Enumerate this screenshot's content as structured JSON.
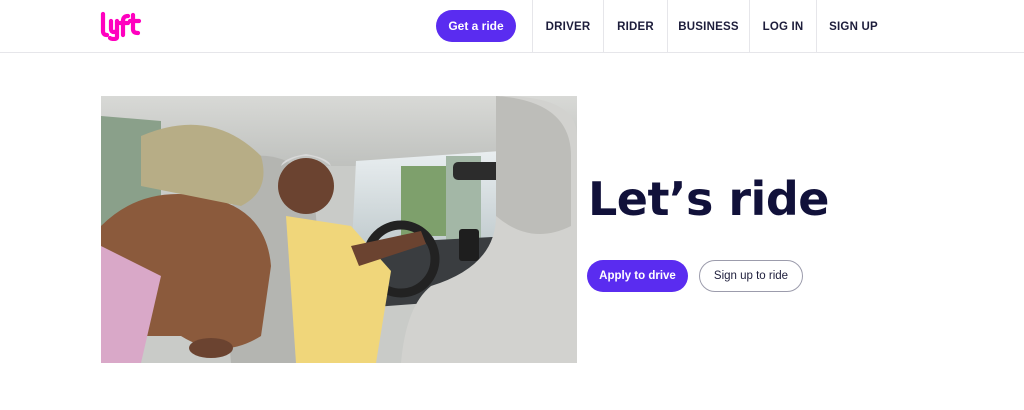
{
  "brand": {
    "logo_text": "lyft",
    "accent_color": "#5a2cf0",
    "logo_color": "#ff00bf"
  },
  "header": {
    "cta_label": "Get a ride",
    "nav": [
      "DRIVER",
      "RIDER",
      "BUSINESS",
      "LOG IN",
      "SIGN UP"
    ]
  },
  "hero": {
    "headline": "Let’s ride",
    "primary_button": "Apply to drive",
    "secondary_button": "Sign up to ride",
    "image_icon": "rideshare-photo"
  }
}
